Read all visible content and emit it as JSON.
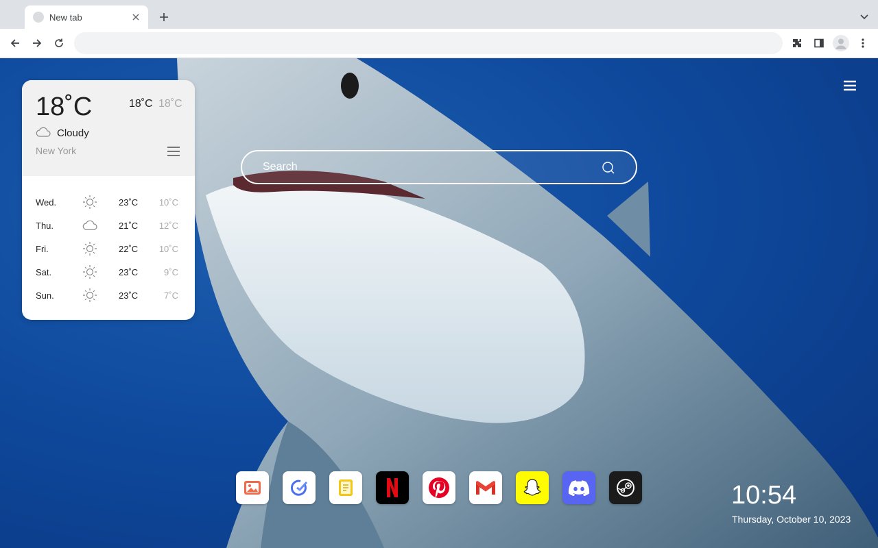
{
  "browser": {
    "tab_title": "New tab",
    "omnibox_value": "",
    "icons": [
      "close-icon",
      "plus-icon",
      "chevron-down-icon",
      "back-icon",
      "forward-icon",
      "reload-icon",
      "extensions-icon",
      "side-panel-icon",
      "profile-icon",
      "more-icon"
    ]
  },
  "weather": {
    "current_temp": "18˚C",
    "high": "18˚C",
    "low": "18˚C",
    "condition": "Cloudy",
    "condition_icon": "cloud-icon",
    "city": "New York",
    "forecast": [
      {
        "day": "Wed.",
        "icon": "sun-icon",
        "high": "23˚C",
        "low": "10˚C"
      },
      {
        "day": "Thu.",
        "icon": "cloud-icon",
        "high": "21˚C",
        "low": "12˚C"
      },
      {
        "day": "Fri.",
        "icon": "sun-icon",
        "high": "22˚C",
        "low": "10˚C"
      },
      {
        "day": "Sat.",
        "icon": "sun-icon",
        "high": "23˚C",
        "low": "9˚C"
      },
      {
        "day": "Sun.",
        "icon": "sun-icon",
        "high": "23˚C",
        "low": "7˚C"
      }
    ]
  },
  "search": {
    "placeholder": "Search"
  },
  "dock": [
    {
      "name": "photos-icon",
      "bg": "#ffffff",
      "accent": "#f06b4a"
    },
    {
      "name": "tasks-icon",
      "bg": "#ffffff",
      "accent": "#4a6ff0"
    },
    {
      "name": "notes-icon",
      "bg": "#ffffff",
      "accent": "#f5c518"
    },
    {
      "name": "netflix-icon",
      "bg": "#000000",
      "accent": "#e50914"
    },
    {
      "name": "pinterest-icon",
      "bg": "#ffffff",
      "accent": "#e60023"
    },
    {
      "name": "gmail-icon",
      "bg": "#ffffff",
      "accent": "#d93025"
    },
    {
      "name": "snapchat-icon",
      "bg": "#fffc00",
      "accent": "#ffffff"
    },
    {
      "name": "discord-icon",
      "bg": "#5865f2",
      "accent": "#ffffff"
    },
    {
      "name": "steam-icon",
      "bg": "#1b1b1b",
      "accent": "#ffffff"
    }
  ],
  "clock": {
    "time": "10:54",
    "date": "Thursday, October 10, 2023"
  },
  "colors": {
    "ocean": "#0f4a9e",
    "card": "#ffffff",
    "card_header": "#f1f1f1"
  }
}
